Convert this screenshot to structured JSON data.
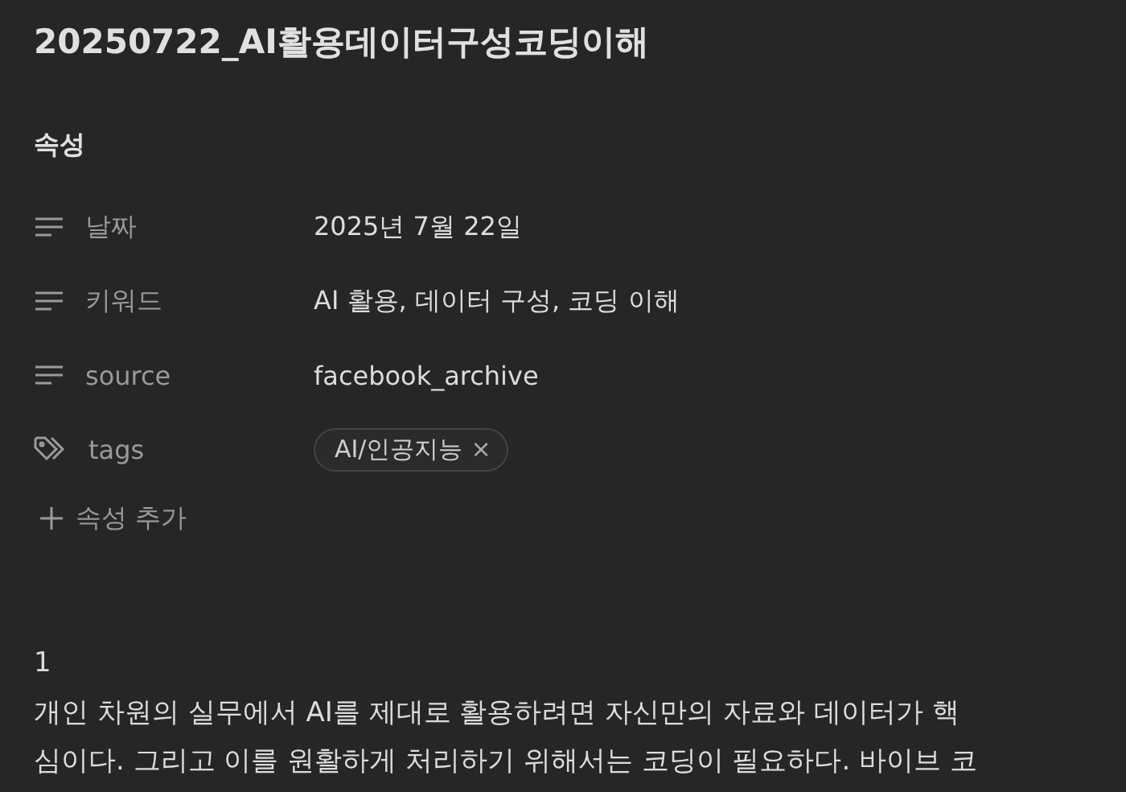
{
  "title": "20250722_AI활용데이터구성코딩이해",
  "properties_heading": "속성",
  "properties": [
    {
      "kind": "text",
      "label": "날짜",
      "value": "2025년 7월 22일"
    },
    {
      "kind": "text",
      "label": "키워드",
      "value": "AI 활용, 데이터 구성, 코딩 이해"
    },
    {
      "kind": "text",
      "label": "source",
      "value": "facebook_archive"
    },
    {
      "kind": "tags",
      "label": "tags",
      "tags": [
        {
          "label": "AI/인공지능",
          "remove": "×"
        }
      ]
    }
  ],
  "add_property": "속성 추가",
  "body": {
    "heading": "1",
    "lines": [
      "개인 차원의 실무에서 AI를 제대로 활용하려면 자신만의 자료와 데이터가 핵",
      "심이다. 그리고 이를 원활하게 처리하기 위해서는 코딩이 필요하다. 바이브 코"
    ]
  }
}
